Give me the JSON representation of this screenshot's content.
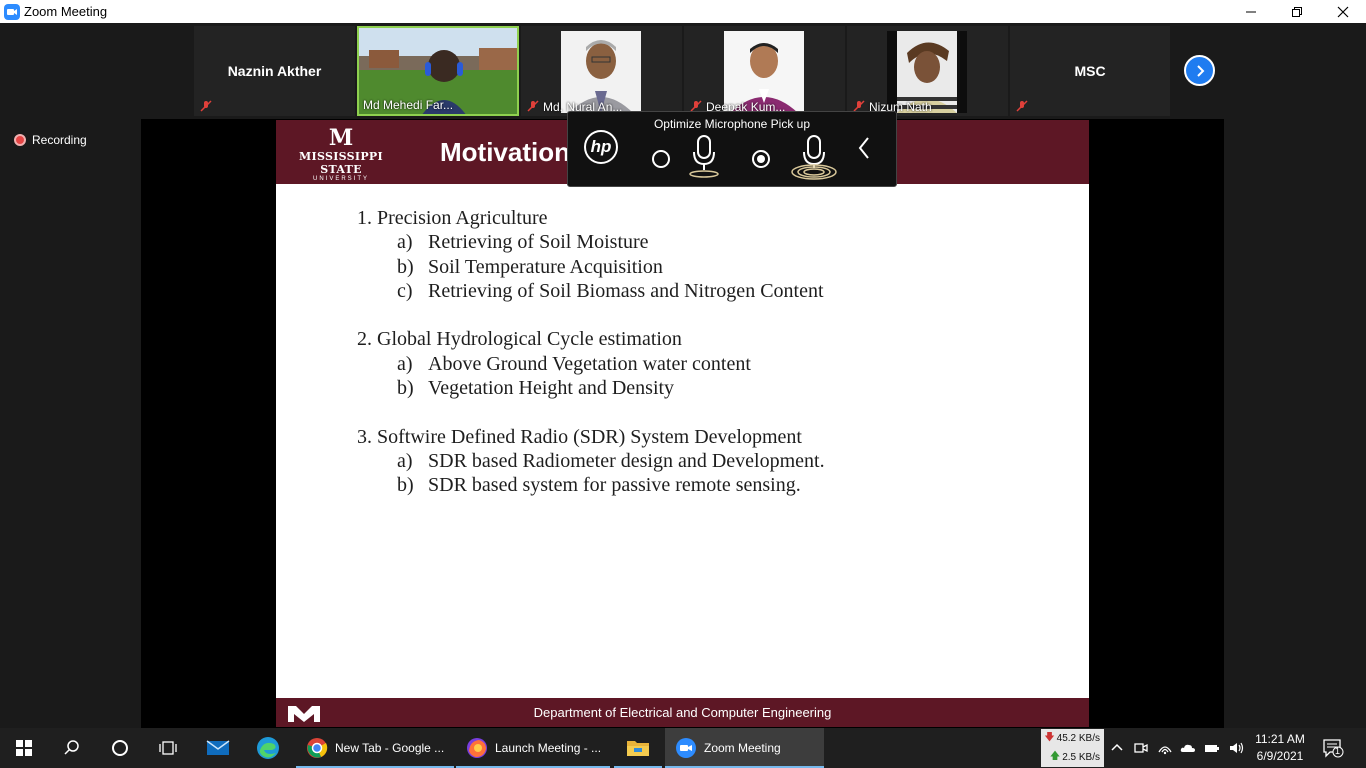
{
  "window": {
    "title": "Zoom Meeting",
    "controls": [
      "minimize-icon",
      "restore-icon",
      "close-icon"
    ]
  },
  "participants": [
    {
      "name": "Naznin Akther",
      "video": false,
      "muted": true
    },
    {
      "name": "Md Mehedi Far...",
      "video": true,
      "muted": false,
      "active_speaker": true
    },
    {
      "name": "Md. Nural An...",
      "video": true,
      "muted": true
    },
    {
      "name": "Deepak Kum...",
      "video": true,
      "muted": true
    },
    {
      "name": "Nizum Nath",
      "video": true,
      "muted": true
    },
    {
      "name": "MSC",
      "video": false,
      "muted": true
    }
  ],
  "recording": {
    "label": "Recording"
  },
  "hp_overlay": {
    "title": "Optimize Microphone Pick up",
    "logo": "hp",
    "modes": [
      {
        "icon": "single-mic-icon",
        "selected": false
      },
      {
        "icon": "multi-mic-icon",
        "selected": true
      }
    ],
    "collapse_icon": "chevron-left-icon"
  },
  "slide": {
    "logo_m": "M",
    "logo_state": "STATE",
    "logo_name": "MISSISSIPPI STATE",
    "logo_univ": "UNIVERSITY",
    "title": "Motivation",
    "sections": [
      {
        "heading": "1. Precision Agriculture",
        "items": [
          {
            "letter": "a)",
            "text": "Retrieving of Soil Moisture"
          },
          {
            "letter": "b)",
            "text": "Soil Temperature Acquisition"
          },
          {
            "letter": "c)",
            "text": "Retrieving of Soil Biomass and Nitrogen Content"
          }
        ]
      },
      {
        "heading": "2. Global Hydrological Cycle estimation",
        "items": [
          {
            "letter": "a)",
            "text": "Above Ground Vegetation water content"
          },
          {
            "letter": "b)",
            "text": "Vegetation Height and Density"
          }
        ]
      },
      {
        "heading": "3. Softwire Defined Radio (SDR) System Development",
        "items": [
          {
            "letter": "a)",
            "text": "SDR based Radiometer design and Development."
          },
          {
            "letter": "b)",
            "text": "SDR based system for passive remote sensing."
          }
        ]
      }
    ],
    "footer": "Department of Electrical and Computer Engineering"
  },
  "taskbar": {
    "apps": [
      {
        "label": "New Tab - Google ...",
        "icon": "chrome-icon",
        "active": false
      },
      {
        "label": "Launch Meeting - ...",
        "icon": "firefox-icon",
        "active": false
      },
      {
        "label": "",
        "icon": "file-explorer-icon",
        "active": false
      },
      {
        "label": "Zoom Meeting",
        "icon": "zoom-icon",
        "active": true
      }
    ],
    "net_down": "45.2 KB/s",
    "net_up": "2.5 KB/s",
    "time": "11:21 AM",
    "date": "6/9/2021",
    "notifications": "1"
  },
  "colors": {
    "msu_maroon": "#5d1725",
    "zoom_blue": "#1f7cf0",
    "active_speaker": "#8fd14f",
    "recording_red": "#e64545"
  }
}
